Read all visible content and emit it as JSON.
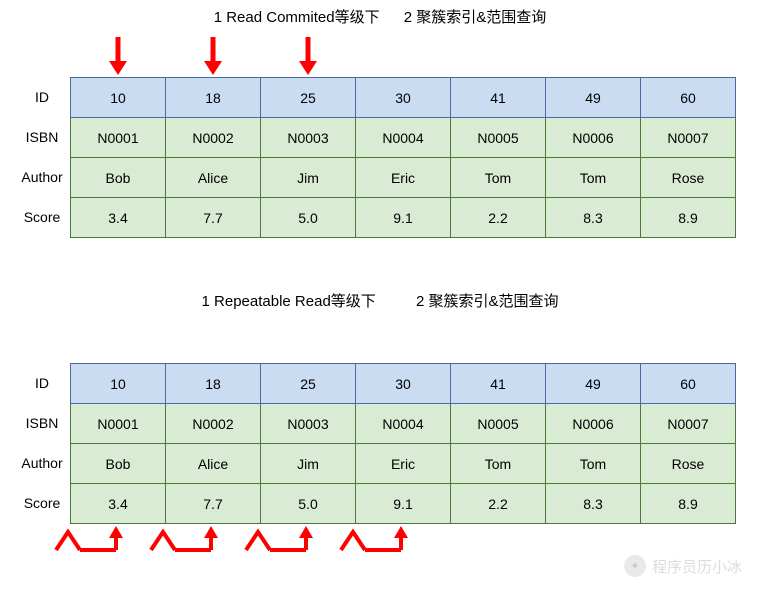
{
  "section1": {
    "title_a": "1 Read Commited等级下",
    "title_b": "2 聚簇索引&范围查询",
    "row_labels": [
      "ID",
      "ISBN",
      "Author",
      "Score"
    ],
    "arrow_cols": [
      0,
      1,
      2
    ],
    "rows": {
      "id": [
        "10",
        "18",
        "25",
        "30",
        "41",
        "49",
        "60"
      ],
      "isbn": [
        "N0001",
        "N0002",
        "N0003",
        "N0004",
        "N0005",
        "N0006",
        "N0007"
      ],
      "author": [
        "Bob",
        "Alice",
        "Jim",
        "Eric",
        "Tom",
        "Tom",
        "Rose"
      ],
      "score": [
        "3.4",
        "7.7",
        "5.0",
        "9.1",
        "2.2",
        "8.3",
        "8.9"
      ]
    }
  },
  "section2": {
    "title_a": "1 Repeatable Read等级下",
    "title_b": "2 聚簇索引&范围查询",
    "row_labels": [
      "ID",
      "ISBN",
      "Author",
      "Score"
    ],
    "gap_arrow_cols": [
      0,
      1,
      2,
      3
    ],
    "rows": {
      "id": [
        "10",
        "18",
        "25",
        "30",
        "41",
        "49",
        "60"
      ],
      "isbn": [
        "N0001",
        "N0002",
        "N0003",
        "N0004",
        "N0005",
        "N0006",
        "N0007"
      ],
      "author": [
        "Bob",
        "Alice",
        "Jim",
        "Eric",
        "Tom",
        "Tom",
        "Rose"
      ],
      "score": [
        "3.4",
        "7.7",
        "5.0",
        "9.1",
        "2.2",
        "8.3",
        "8.9"
      ]
    }
  },
  "watermark": "程序员历小冰",
  "chart_data": [
    {
      "type": "table",
      "title": "Read Committed — 聚簇索引&范围查询",
      "columns": [
        "ID",
        "ISBN",
        "Author",
        "Score"
      ],
      "rows": [
        [
          10,
          "N0001",
          "Bob",
          3.4
        ],
        [
          18,
          "N0002",
          "Alice",
          7.7
        ],
        [
          25,
          "N0003",
          "Jim",
          5.0
        ],
        [
          30,
          "N0004",
          "Eric",
          9.1
        ],
        [
          41,
          "N0005",
          "Tom",
          2.2
        ],
        [
          49,
          "N0006",
          "Tom",
          8.3
        ],
        [
          60,
          "N0007",
          "Rose",
          8.9
        ]
      ],
      "locked_records": [
        10,
        18,
        25
      ]
    },
    {
      "type": "table",
      "title": "Repeatable Read — 聚簇索引&范围查询",
      "columns": [
        "ID",
        "ISBN",
        "Author",
        "Score"
      ],
      "rows": [
        [
          10,
          "N0001",
          "Bob",
          3.4
        ],
        [
          18,
          "N0002",
          "Alice",
          7.7
        ],
        [
          25,
          "N0003",
          "Jim",
          5.0
        ],
        [
          30,
          "N0004",
          "Eric",
          9.1
        ],
        [
          41,
          "N0005",
          "Tom",
          2.2
        ],
        [
          49,
          "N0006",
          "Tom",
          8.3
        ],
        [
          60,
          "N0007",
          "Rose",
          8.9
        ]
      ],
      "gap_lock_ranges": [
        "(-∞,10]",
        "(10,18]",
        "(18,25]",
        "(25,30]"
      ]
    }
  ]
}
